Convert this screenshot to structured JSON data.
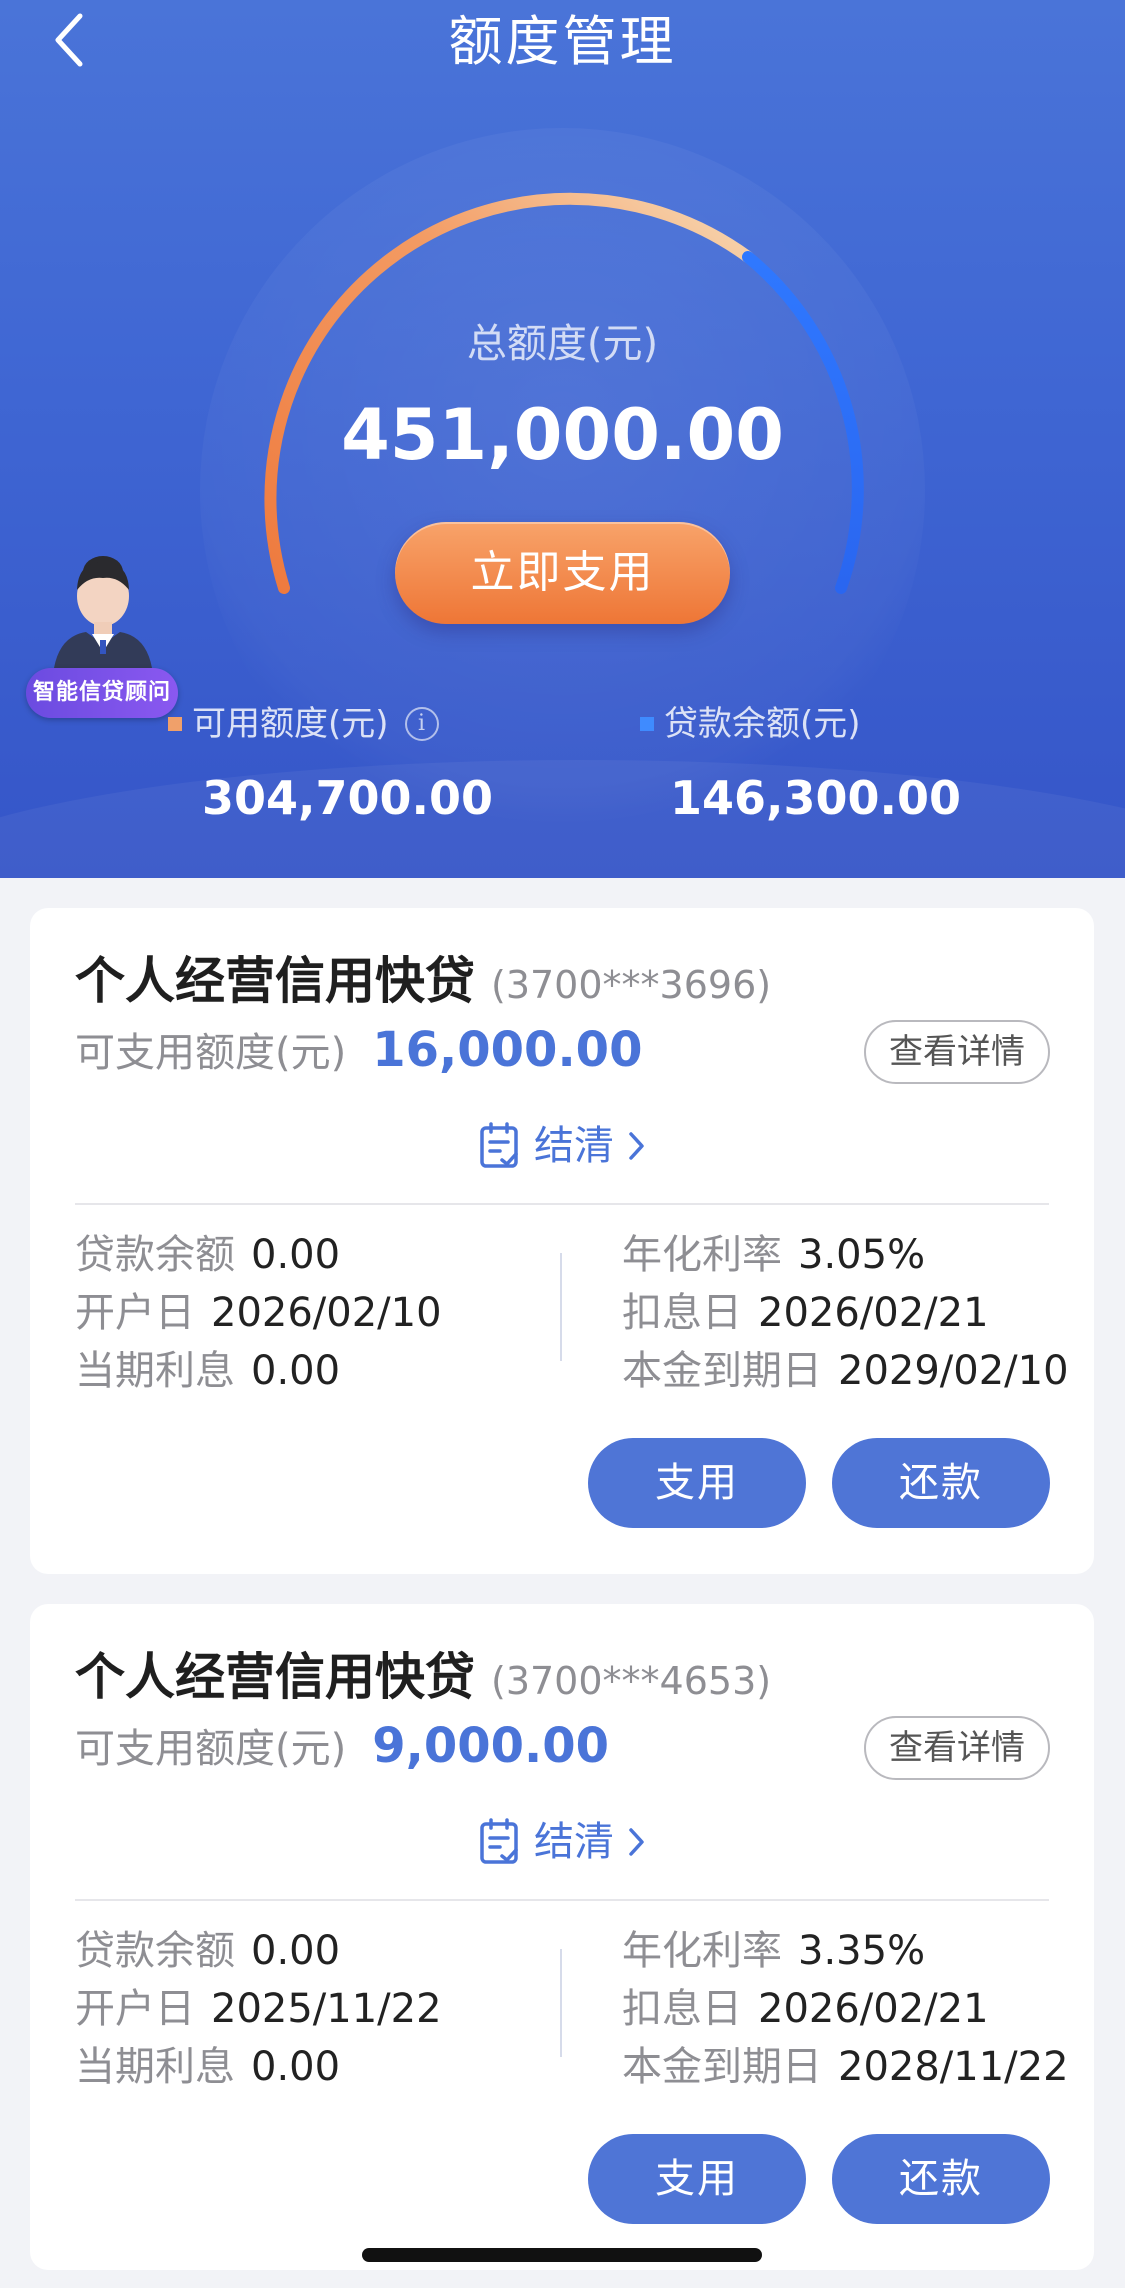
{
  "header": {
    "title": "额度管理",
    "total_label": "总额度(元)",
    "total_value": "451,000.00",
    "use_now_label": "立即支用",
    "advisor_label": "智能信贷顾问",
    "available_label": "可用额度(元)",
    "available_value": "304,700.00",
    "balance_label": "贷款余额(元)",
    "balance_value": "146,300.00",
    "gauge_used_fraction": 0.32
  },
  "labels": {
    "available_quota": "可支用额度(元)",
    "detail_button": "查看详情",
    "settle": "结清",
    "loan_balance": "贷款余额",
    "open_date": "开户日",
    "current_interest": "当期利息",
    "annual_rate": "年化利率",
    "interest_date": "扣息日",
    "maturity_date": "本金到期日",
    "draw_button": "支用",
    "repay_button": "还款"
  },
  "loans": [
    {
      "name": "个人经营信用快贷",
      "account": "(3700***3696)",
      "available": "16,000.00",
      "balance": "0.00",
      "open_date": "2026/02/10",
      "current_interest": "0.00",
      "annual_rate": "3.05%",
      "interest_date": "2026/02/21",
      "maturity_date": "2029/02/10"
    },
    {
      "name": "个人经营信用快贷",
      "account": "(3700***4653)",
      "available": "9,000.00",
      "balance": "0.00",
      "open_date": "2025/11/22",
      "current_interest": "0.00",
      "annual_rate": "3.35%",
      "interest_date": "2026/02/21",
      "maturity_date": "2028/11/22"
    }
  ],
  "colors": {
    "brand_blue": "#4a74d8",
    "orange": "#ee7636",
    "gauge_orange": "#f08a4e",
    "gauge_blue": "#2f7bff"
  }
}
